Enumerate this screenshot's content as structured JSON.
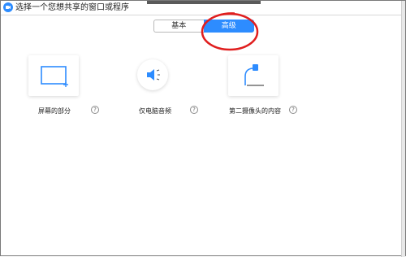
{
  "window": {
    "title": "选择一个您想共享的窗口或程序"
  },
  "tabs": [
    {
      "label": "基本",
      "selected": false
    },
    {
      "label": "高级",
      "selected": true
    }
  ],
  "options": [
    {
      "label": "屏幕的部分",
      "help": "?",
      "icon": "screen-portion-icon"
    },
    {
      "label": "仅电脑音频",
      "help": "?",
      "icon": "speaker-icon"
    },
    {
      "label": "第二摄像头的内容",
      "help": "?",
      "icon": "second-camera-icon"
    }
  ],
  "colors": {
    "accent": "#2d8cff",
    "annotation": "#e01e1e"
  }
}
